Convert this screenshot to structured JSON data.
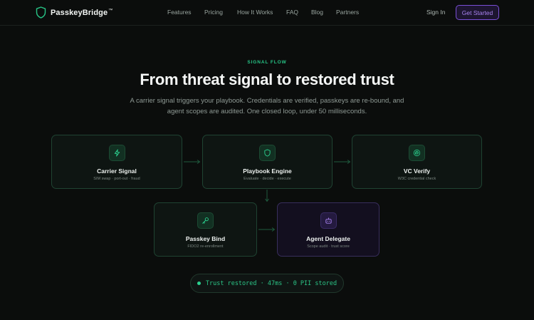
{
  "brand": {
    "name": "PasskeyBridge",
    "trademark": "™"
  },
  "nav": {
    "links": [
      "Features",
      "Pricing",
      "How It Works",
      "FAQ",
      "Blog",
      "Partners"
    ],
    "sign_in": "Sign In",
    "get_started": "Get Started"
  },
  "hero": {
    "eyebrow": "SIGNAL FLOW",
    "title": "From threat signal to restored trust",
    "subtitle": "A carrier signal triggers your playbook. Credentials are verified, passkeys are re-bound, and agent scopes are audited. One closed loop, under 50 milliseconds."
  },
  "flow": [
    {
      "title": "Carrier Signal",
      "subtitle": "SIM swap · port-out · fraud",
      "icon": "lightning-icon",
      "accent": "green"
    },
    {
      "title": "Playbook Engine",
      "subtitle": "Evaluate · decide · execute",
      "icon": "shield-icon",
      "accent": "green"
    },
    {
      "title": "VC Verify",
      "subtitle": "W3C credential check",
      "icon": "fingerprint-icon",
      "accent": "green"
    },
    {
      "title": "Passkey Bind",
      "subtitle": "FIDO2 re-enrollment",
      "icon": "key-icon",
      "accent": "green"
    },
    {
      "title": "Agent Delegate",
      "subtitle": "Scope audit · trust score",
      "icon": "robot-icon",
      "accent": "purple"
    }
  ],
  "status": {
    "text": "Trust restored · 47ms · 0 PII stored"
  },
  "colors": {
    "background": "#0b0d0c",
    "accent_green": "#27c486",
    "accent_purple": "#a983f0",
    "card_border_green": "#1f4332",
    "card_border_purple": "#382e5c"
  }
}
